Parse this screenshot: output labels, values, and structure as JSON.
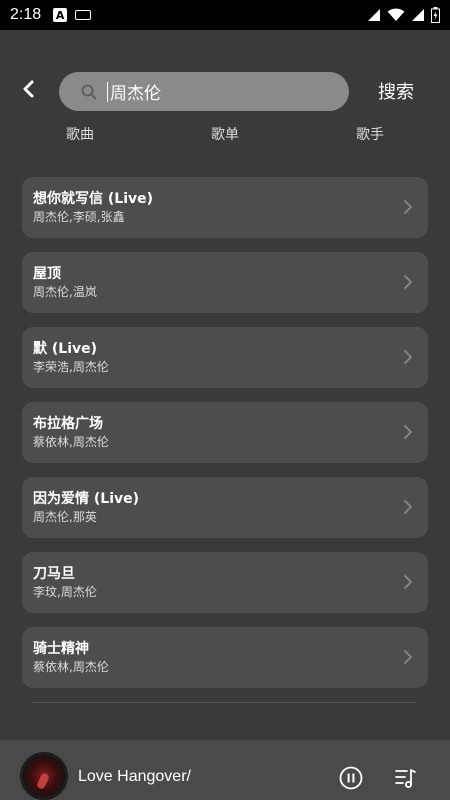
{
  "status_bar": {
    "time": "2:18",
    "notification_icon": "A"
  },
  "header": {
    "search_value": "周杰伦",
    "search_button_label": "搜索"
  },
  "tabs": [
    {
      "label": "歌曲",
      "selected": true
    },
    {
      "label": "歌单",
      "selected": false
    },
    {
      "label": "歌手",
      "selected": false
    }
  ],
  "songs": [
    {
      "title": "想你就写信 (Live)",
      "artists": "周杰伦,李硕,张鑫"
    },
    {
      "title": "屋顶",
      "artists": "周杰伦,温岚"
    },
    {
      "title": "默 (Live)",
      "artists": "李荣浩,周杰伦"
    },
    {
      "title": "布拉格广场",
      "artists": "蔡依林,周杰伦"
    },
    {
      "title": "因为爱情 (Live)",
      "artists": "周杰伦,那英"
    },
    {
      "title": "刀马旦",
      "artists": "李玟,周杰伦"
    },
    {
      "title": "骑士精神",
      "artists": "蔡依林,周杰伦"
    }
  ],
  "player": {
    "now_playing": "Love Hangover/",
    "state": "playing"
  },
  "colors": {
    "background": "#3a3a3a",
    "card": "#4d4d4d",
    "search_box": "#8a8a8a",
    "player_bar": "#4a4a4a",
    "status_bar": "#000000"
  },
  "icons": [
    "back-arrow-icon",
    "search-icon",
    "chevron-right-icon",
    "pause-icon",
    "playlist-icon",
    "wifi-icon",
    "signal-icon",
    "battery-icon",
    "keyboard-icon"
  ]
}
